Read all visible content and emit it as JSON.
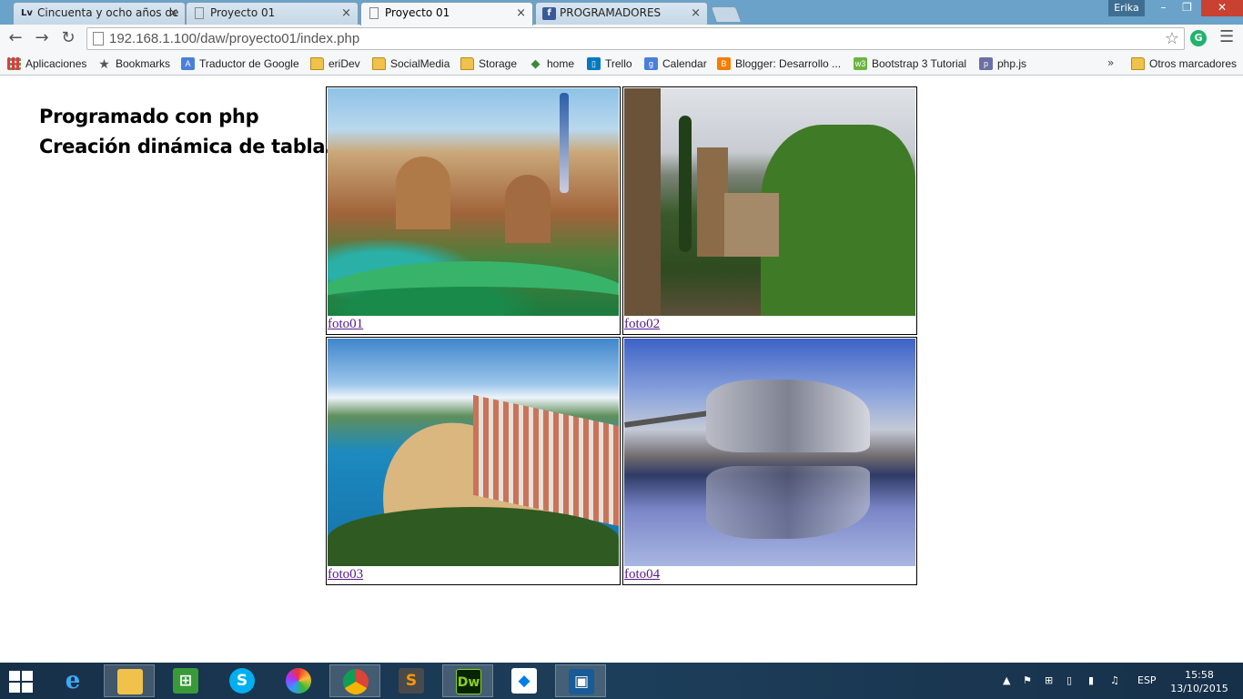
{
  "browser": {
    "tabs": [
      {
        "label": "Cincuenta y ocho años de",
        "favicon": "Lv",
        "active": false
      },
      {
        "label": "Proyecto 01",
        "favicon": "page-icon",
        "active": false
      },
      {
        "label": "Proyecto 01",
        "favicon": "page-icon",
        "active": true
      },
      {
        "label": "PROGRAMADORES",
        "favicon": "f",
        "active": false
      }
    ],
    "user": "Erika",
    "close_glyph": "×",
    "url": "192.168.1.100/daw/proyecto01/index.php",
    "bookmarks": [
      {
        "label": "Aplicaciones",
        "icon": "apps-icon"
      },
      {
        "label": "Bookmarks",
        "icon": "star-icon"
      },
      {
        "label": "Traductor de Google",
        "icon": "translate-icon"
      },
      {
        "label": "eriDev",
        "icon": "folder-icon"
      },
      {
        "label": "SocialMedia",
        "icon": "folder-icon"
      },
      {
        "label": "Storage",
        "icon": "folder-icon"
      },
      {
        "label": "home",
        "icon": "diamond-icon"
      },
      {
        "label": "Trello",
        "icon": "trello-icon"
      },
      {
        "label": "Calendar",
        "icon": "google-icon"
      },
      {
        "label": "Blogger: Desarrollo ...",
        "icon": "blogger-icon"
      },
      {
        "label": "Bootstrap 3 Tutorial",
        "icon": "w3-icon"
      },
      {
        "label": "php.js",
        "icon": "php-icon"
      }
    ],
    "more_bookmarks": "»",
    "other_bookmarks": "Otros marcadores"
  },
  "page": {
    "heading_line1": "Programado con php",
    "heading_line2": "Creación dinámica de tabla.",
    "photos": [
      {
        "link": "foto01",
        "subject": "park-mosaic-photo"
      },
      {
        "link": "foto02",
        "subject": "castle-photo"
      },
      {
        "link": "foto03",
        "subject": "beach-town-photo"
      },
      {
        "link": "foto04",
        "subject": "museum-reflection-photo"
      }
    ]
  },
  "taskbar": {
    "apps": [
      "internet-explorer-icon",
      "file-explorer-icon",
      "store-icon",
      "skype-icon",
      "picasa-icon",
      "chrome-icon",
      "sublime-icon",
      "dreamweaver-icon",
      "dropbox-icon",
      "virtualbox-icon"
    ],
    "app_letters": {
      "ie": "e",
      "store": "⊞",
      "skype": "S",
      "sublime": "S",
      "dreamweaver": "Dw",
      "dropbox": "◆"
    },
    "language": "ESP",
    "time": "15:58",
    "date": "13/10/2015"
  },
  "colors": {
    "link": "#551a8b",
    "titlebar": "#6aa2c9",
    "close": "#c94131"
  }
}
